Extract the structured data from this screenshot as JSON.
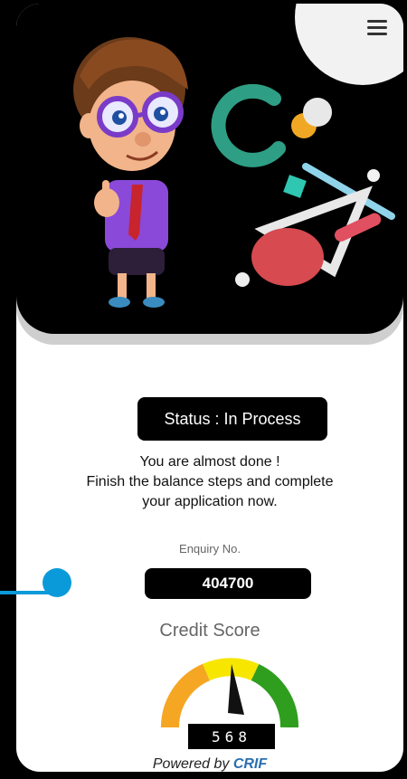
{
  "status": {
    "text": "Status : In Process"
  },
  "message": {
    "line1": "You are almost done !",
    "line2": "Finish the balance steps and complete",
    "line3": "your application now."
  },
  "enquiry": {
    "label": "Enquiry No.",
    "value": "404700"
  },
  "credit": {
    "label": "Credit Score",
    "score": "568"
  },
  "footer": {
    "powered_by": "Powered by",
    "brand": "CRIF"
  },
  "icons": {
    "menu": "hamburger-icon",
    "pointer": "annotation-pointer"
  },
  "colors": {
    "pointer": "#0b9ad9",
    "gauge_orange": "#f5a623",
    "gauge_yellow": "#f6e600",
    "gauge_green": "#2f9e1f"
  }
}
